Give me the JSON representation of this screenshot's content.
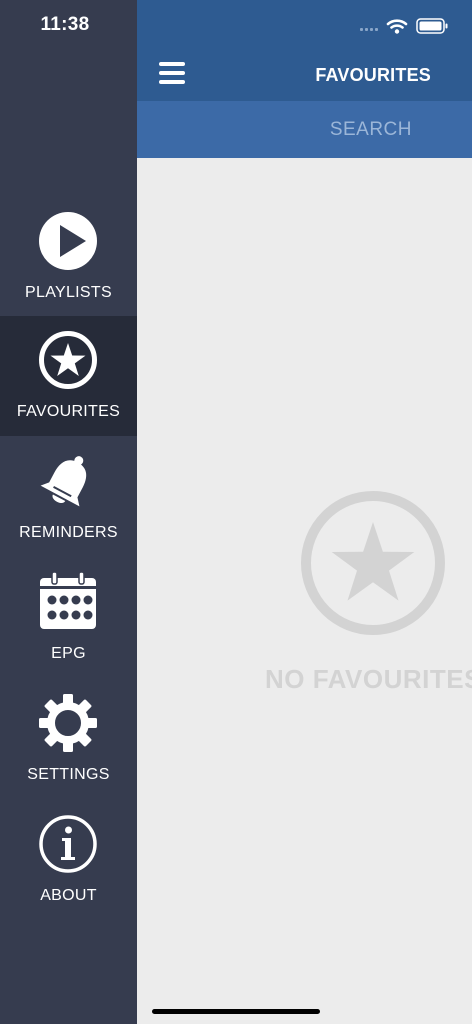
{
  "status_bar": {
    "time": "11:38"
  },
  "nav": {
    "items": [
      {
        "label": "PLAYLISTS",
        "icon": "play-circle-icon"
      },
      {
        "label": "FAVOURITES",
        "icon": "star-circle-icon",
        "active": true
      },
      {
        "label": "REMINDERS",
        "icon": "bell-icon"
      },
      {
        "label": "EPG",
        "icon": "calendar-icon"
      },
      {
        "label": "SETTINGS",
        "icon": "gear-icon"
      },
      {
        "label": "ABOUT",
        "icon": "info-icon"
      }
    ]
  },
  "header": {
    "title": "FAVOURITES",
    "menu_icon": "hamburger-icon"
  },
  "search": {
    "placeholder": "SEARCH",
    "value": ""
  },
  "empty_state": {
    "icon": "star-circle-icon",
    "message": "NO FAVOURITES"
  },
  "colors": {
    "sidebar": "#363c4f",
    "sidebar_active": "#262b39",
    "header": "#2e5b91",
    "search_bar": "#3c6aa7",
    "content_bg": "#ececec",
    "empty_state": "#d3d3d3"
  }
}
